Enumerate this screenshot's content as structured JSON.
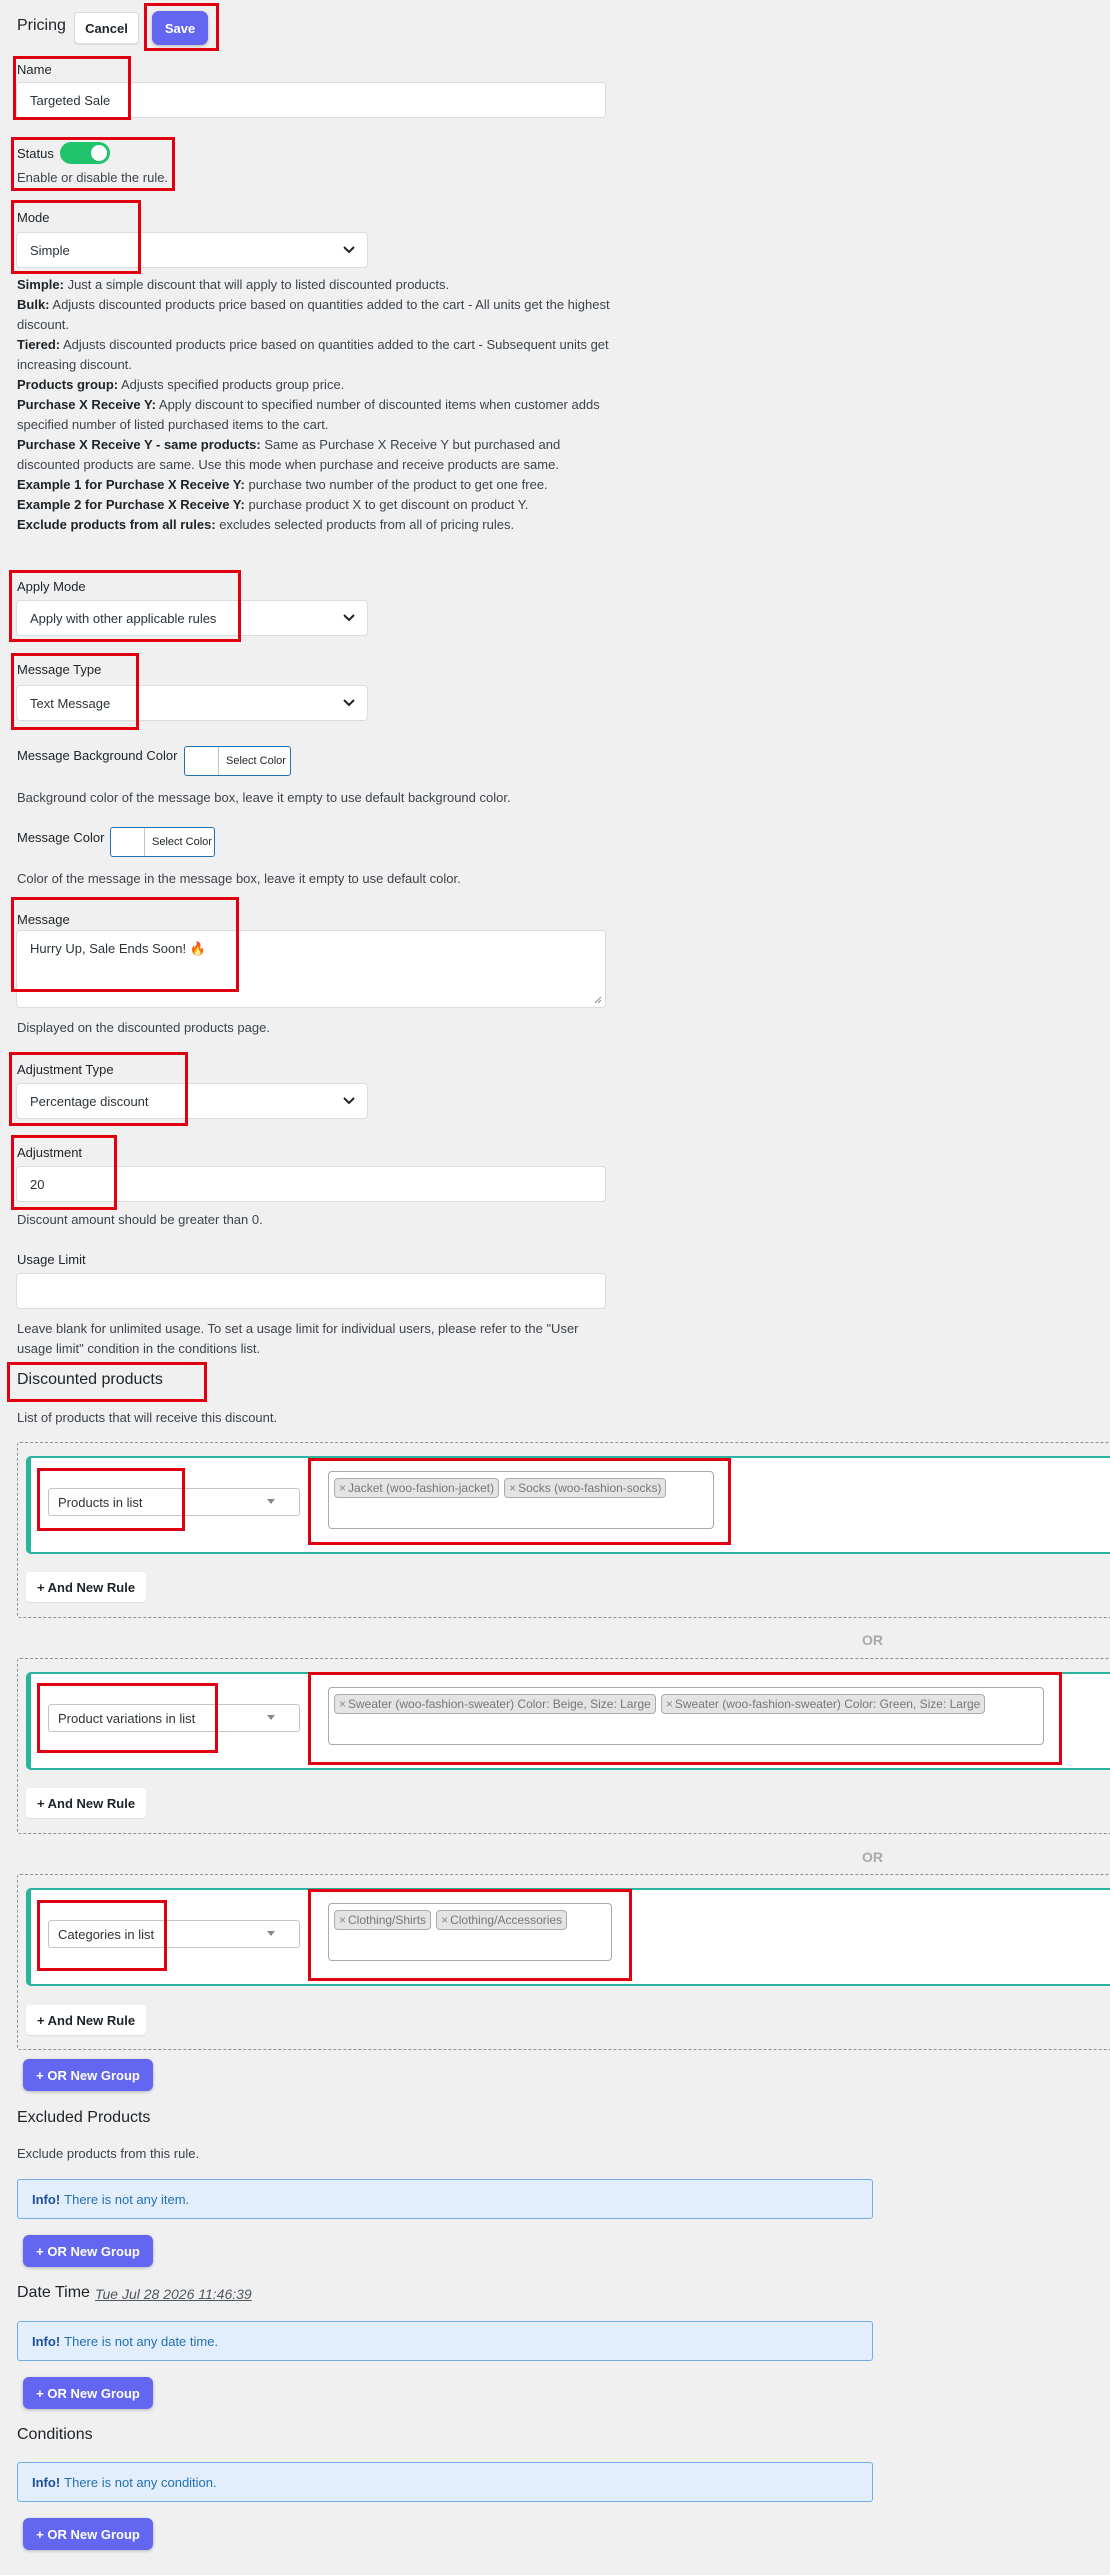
{
  "header": {
    "title": "Pricing",
    "cancel_label": "Cancel",
    "save_label": "Save"
  },
  "name": {
    "label": "Name",
    "value": "Targeted Sale"
  },
  "status": {
    "label": "Status",
    "enabled": true,
    "help": "Enable or disable the rule."
  },
  "mode": {
    "label": "Mode",
    "value": "Simple",
    "descriptions": [
      {
        "term": "Simple:",
        "text": " Just a simple discount that will apply to listed discounted products."
      },
      {
        "term": "Bulk:",
        "text": " Adjusts discounted products price based on quantities added to the cart - All units get the highest discount."
      },
      {
        "term": "Tiered:",
        "text": " Adjusts discounted products price based on quantities added to the cart - Subsequent units get increasing discount."
      },
      {
        "term": "Products group:",
        "text": " Adjusts specified products group price."
      },
      {
        "term": "Purchase X Receive Y:",
        "text": " Apply discount to specified number of discounted items when customer adds specified number of listed purchased items to the cart."
      },
      {
        "term": "Purchase X Receive Y - same products:",
        "text": " Same as Purchase X Receive Y but purchased and discounted products are same. Use this mode when purchase and receive products are same."
      },
      {
        "term": "Example 1 for Purchase X Receive Y:",
        "text": " purchase two number of the product to get one free."
      },
      {
        "term": "Example 2 for Purchase X Receive Y:",
        "text": " purchase product X to get discount on product Y."
      },
      {
        "term": "Exclude products from all rules:",
        "text": " excludes selected products from all of pricing rules."
      }
    ]
  },
  "apply_mode": {
    "label": "Apply Mode",
    "value": "Apply with other applicable rules"
  },
  "message_type": {
    "label": "Message Type",
    "value": "Text Message"
  },
  "message_bg": {
    "label": "Message Background Color",
    "button": "Select Color",
    "help": "Background color of the message box, leave it empty to use default background color."
  },
  "message_color": {
    "label": "Message Color",
    "button": "Select Color",
    "help": "Color of the message in the message box, leave it empty to use default color."
  },
  "message": {
    "label": "Message",
    "value": "Hurry Up, Sale Ends Soon! 🔥",
    "help": "Displayed on the discounted products page."
  },
  "adjustment_type": {
    "label": "Adjustment Type",
    "value": "Percentage discount"
  },
  "adjustment": {
    "label": "Adjustment",
    "value": "20",
    "help": "Discount amount should be greater than 0."
  },
  "usage_limit": {
    "label": "Usage Limit",
    "value": "",
    "help_line1": "Leave blank for unlimited usage. To set a usage limit for individual users, please refer to the \"User",
    "help_line2": "usage limit\" condition in the conditions list."
  },
  "discounted_products": {
    "title": "Discounted products",
    "help": "List of products that will receive this discount.",
    "or_label": "OR",
    "and_rule_label": "+ And New Rule",
    "or_group_label": "+ OR New Group",
    "groups": [
      {
        "rule": "Products in list",
        "tags": [
          "Jacket (woo-fashion-jacket)",
          "Socks (woo-fashion-socks)"
        ]
      },
      {
        "rule": "Product variations in list",
        "tags": [
          "Sweater (woo-fashion-sweater) Color: Beige, Size: Large",
          "Sweater (woo-fashion-sweater) Color: Green, Size: Large"
        ]
      },
      {
        "rule": "Categories in list",
        "tags": [
          "Clothing/Shirts",
          "Clothing/Accessories"
        ]
      }
    ]
  },
  "excluded_products": {
    "title": "Excluded Products",
    "help": "Exclude products from this rule.",
    "info_label": "Info!",
    "info_text": "There is not any item.",
    "button": "+ OR New Group"
  },
  "date_time": {
    "title": "Date Time",
    "value": "Tue Jul 28 2026 11:46:39",
    "info_label": "Info!",
    "info_text": "There is not any date time.",
    "button": "+ OR New Group"
  },
  "conditions": {
    "title": "Conditions",
    "info_label": "Info!",
    "info_text": "There is not any condition.",
    "button": "+ OR New Group"
  },
  "colors": {
    "accent": "#6366f1",
    "toggle_on": "#1ec36b",
    "rule_border": "#2ab3a0",
    "highlight": "#e00012"
  }
}
